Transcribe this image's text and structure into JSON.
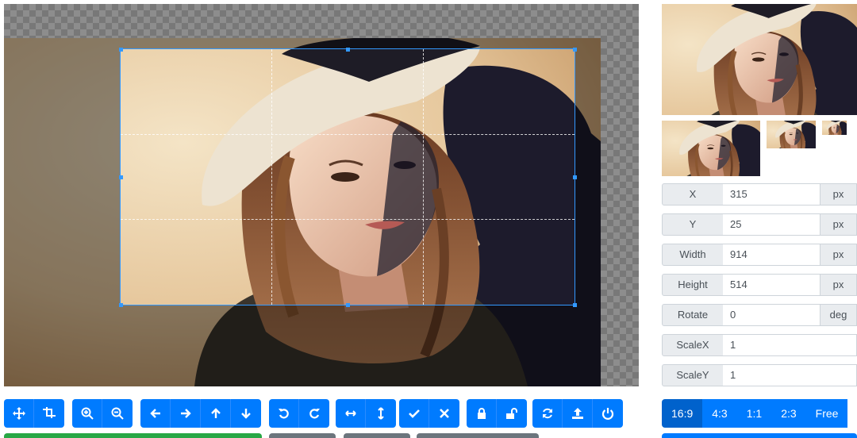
{
  "fields": [
    {
      "label": "X",
      "value": "315",
      "unit": "px"
    },
    {
      "label": "Y",
      "value": "25",
      "unit": "px"
    },
    {
      "label": "Width",
      "value": "914",
      "unit": "px"
    },
    {
      "label": "Height",
      "value": "514",
      "unit": "px"
    },
    {
      "label": "Rotate",
      "value": "0",
      "unit": "deg"
    },
    {
      "label": "ScaleX",
      "value": "1",
      "unit": ""
    },
    {
      "label": "ScaleY",
      "value": "1",
      "unit": ""
    }
  ],
  "aspect_ratios": {
    "options": [
      "16:9",
      "4:3",
      "1:1",
      "2:3",
      "Free"
    ],
    "selected": "16:9"
  },
  "toolbar": {
    "groups": [
      [
        "move-icon",
        "crop-icon"
      ],
      [
        "zoom-in-icon",
        "zoom-out-icon"
      ],
      [
        "arrow-left-icon",
        "arrow-right-icon",
        "arrow-up-icon",
        "arrow-down-icon"
      ],
      [
        "rotate-left-icon",
        "rotate-right-icon"
      ],
      [
        "flip-horizontal-icon",
        "flip-vertical-icon"
      ],
      [
        "crop-confirm-icon",
        "crop-clear-icon"
      ],
      [
        "lock-icon",
        "unlock-icon"
      ],
      [
        "reset-icon",
        "upload-icon",
        "destroy-icon"
      ]
    ]
  },
  "colors": {
    "primary": "#007bff",
    "primary_active": "#0062cc",
    "crop_outline": "#3399ff",
    "success_peek": "#28a745"
  }
}
